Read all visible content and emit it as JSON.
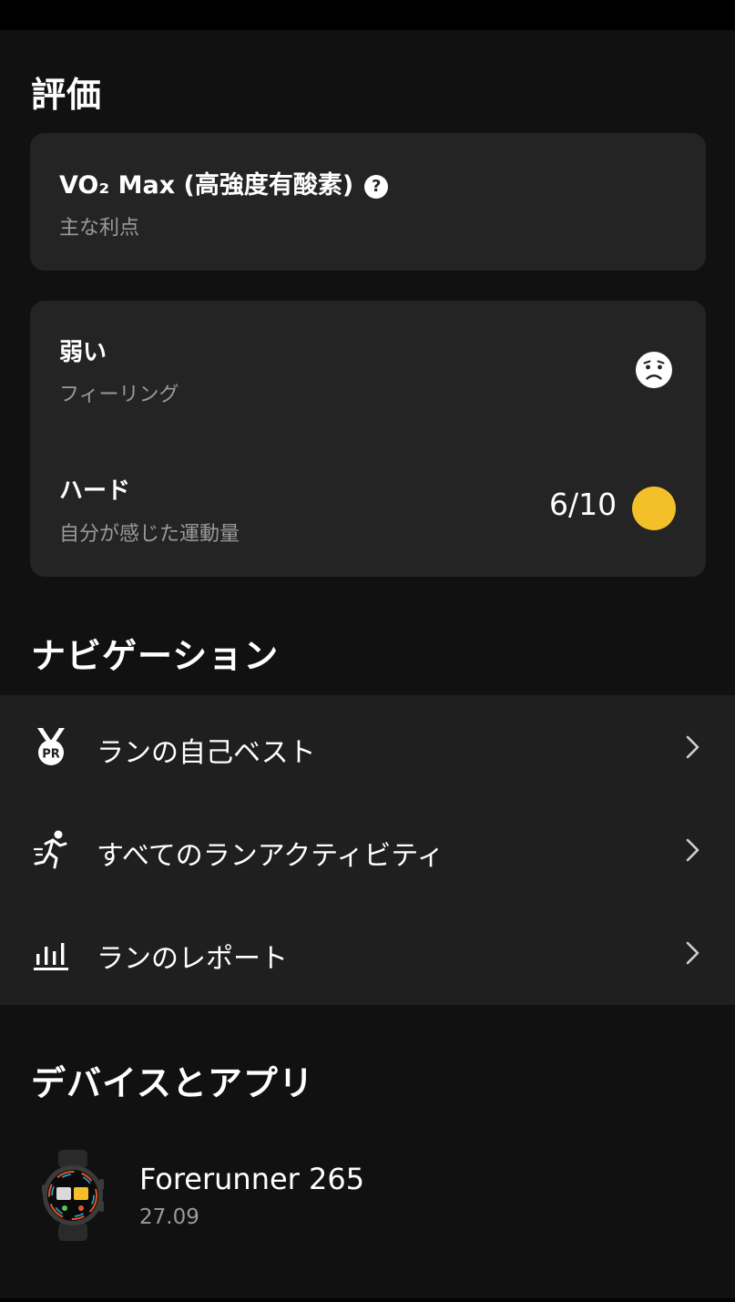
{
  "evaluation": {
    "title": "評価",
    "benefit_card": {
      "title": "VO₂ Max (高強度有酸素)",
      "subtitle": "主な利点",
      "help_glyph": "?"
    },
    "feeling": {
      "value": "弱い",
      "label": "フィーリング",
      "icon": "sad-face-icon"
    },
    "effort": {
      "value": "ハード",
      "label": "自分が感じた運動量",
      "score": "6/10",
      "dot_color": "#F4C02A"
    }
  },
  "navigation": {
    "title": "ナビゲーション",
    "items": [
      {
        "label": "ランの自己ベスト",
        "icon": "pr-medal-icon"
      },
      {
        "label": "すべてのランアクティビティ",
        "icon": "runner-icon"
      },
      {
        "label": "ランのレポート",
        "icon": "bar-chart-icon"
      }
    ]
  },
  "devices": {
    "title": "デバイスとアプリ",
    "device": {
      "name": "Forerunner 265",
      "version": "27.09",
      "icon": "watch-icon"
    }
  }
}
